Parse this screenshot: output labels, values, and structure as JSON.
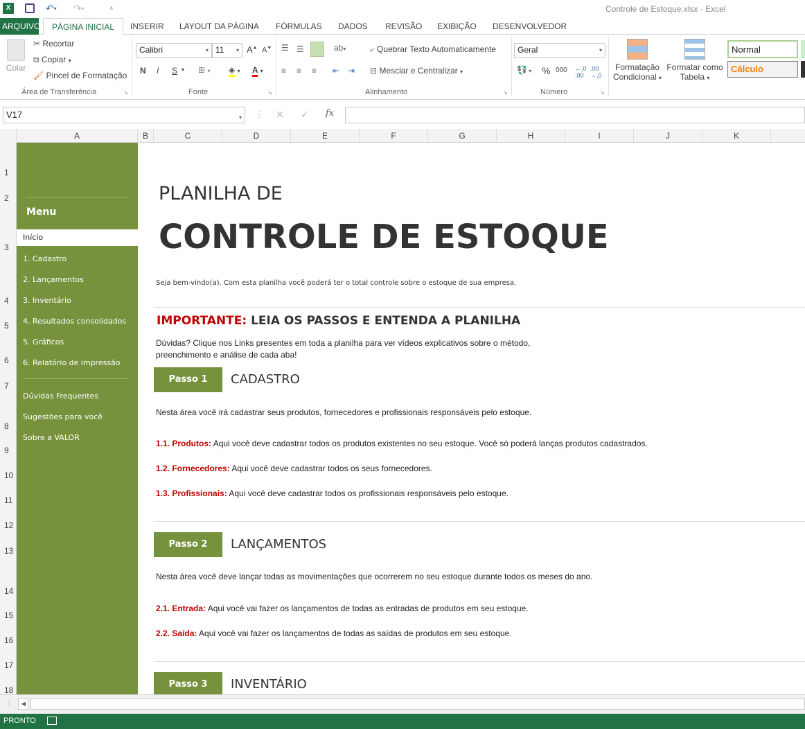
{
  "window": {
    "title": "Controle de Estoque.xlsx - Excel"
  },
  "ribbon_tabs": [
    "ARQUIVO",
    "PÁGINA INICIAL",
    "INSERIR",
    "LAYOUT DA PÁGINA",
    "FÓRMULAS",
    "DADOS",
    "REVISÃO",
    "EXIBIÇÃO",
    "DESENVOLVEDOR"
  ],
  "clipboard": {
    "paste": "Colar",
    "cut": "Recortar",
    "copy": "Copiar",
    "format_painter": "Pincel de Formatação",
    "group": "Área de Transferência"
  },
  "font": {
    "name": "Calibri",
    "size": "11",
    "bold": "N",
    "italic": "I",
    "underline": "S",
    "group": "Fonte"
  },
  "alignment": {
    "wrap": "Quebrar Texto Automaticamente",
    "merge": "Mesclar e Centralizar",
    "group": "Alinhamento"
  },
  "number": {
    "format": "Geral",
    "percent": "%",
    "thousands": "000",
    "group": "Número"
  },
  "styles": {
    "cond_format": "Formatação",
    "cond_format2": "Condicional",
    "format_table": "Formatar como",
    "format_table2": "Tabela",
    "normal": "Normal",
    "calc": "Cálculo"
  },
  "formula_bar": {
    "name_box": "V17",
    "fx": "fx",
    "value": ""
  },
  "columns": [
    "A",
    "B",
    "C",
    "D",
    "E",
    "F",
    "G",
    "H",
    "I",
    "J",
    "K"
  ],
  "rows": [
    "1",
    "2",
    "3",
    "4",
    "5",
    "6",
    "7",
    "8",
    "9",
    "10",
    "11",
    "12",
    "13",
    "14",
    "15",
    "16",
    "17",
    "18"
  ],
  "sidebar": {
    "title": "Menu",
    "items": [
      "Início",
      "1. Cadastro",
      "2. Lançamentos",
      "3. Inventário",
      "4. Resultados consolidados",
      "5. Gráficos",
      "6. Relatório de impressão"
    ],
    "links": [
      "Dúvidas Frequentes",
      "Sugestões para você",
      "Sobre a VALOR"
    ]
  },
  "main": {
    "title1": "PLANILHA DE",
    "title2": "CONTROLE DE ESTOQUE",
    "welcome": "Seja bem-vindo(a). Com esta planilha você poderá ter o total controle sobre o estoque de sua empresa.",
    "important_label": "IMPORTANTE:",
    "important_text": " LEIA OS PASSOS E ENTENDA A PLANILHA",
    "doubts1": "Dúvidas? Clique nos Links presentes em toda a planilha para ver vídeos explicativos sobre o método,",
    "doubts2": "preenchimento e análise de cada aba!",
    "step1": {
      "badge": "Passo 1",
      "title": "CADASTRO",
      "desc": "Nesta área você irá cadastrar seus produtos, fornecedores e profissionais responsáveis pelo estoque.",
      "items": [
        {
          "label": "1.1. Produtos:",
          "text": " Aqui você deve cadastrar todos os produtos existentes no seu estoque. Você só poderá lanças produtos cadastrados."
        },
        {
          "label": "1.2. Fornecedores:",
          "text": " Aqui você deve cadastrar todos os seus fornecedores."
        },
        {
          "label": "1.3. Profissionais:",
          "text": " Aqui você deve cadastrar todos os profissionais responsáveis pelo estoque."
        }
      ]
    },
    "step2": {
      "badge": "Passo 2",
      "title": "LANÇAMENTOS",
      "desc": "Nesta área você deve lançar todas as movimentações que ocorrerem no seu estoque durante todos os meses do ano.",
      "items": [
        {
          "label": "2.1. Entrada:",
          "text": " Aqui você vai fazer os lançamentos de todas as entradas de produtos em seu estoque."
        },
        {
          "label": "2.2. Saída:",
          "text": " Aqui você vai fazer os lançamentos de todas as saídas de produtos em seu estoque."
        }
      ]
    },
    "step3": {
      "badge": "Passo 3",
      "title": "INVENTÁRIO"
    }
  },
  "status": {
    "text": "PRONTO"
  },
  "colors": {
    "excel_green": "#217346",
    "menu_green": "#76923c",
    "accent_red": "#c00000"
  }
}
